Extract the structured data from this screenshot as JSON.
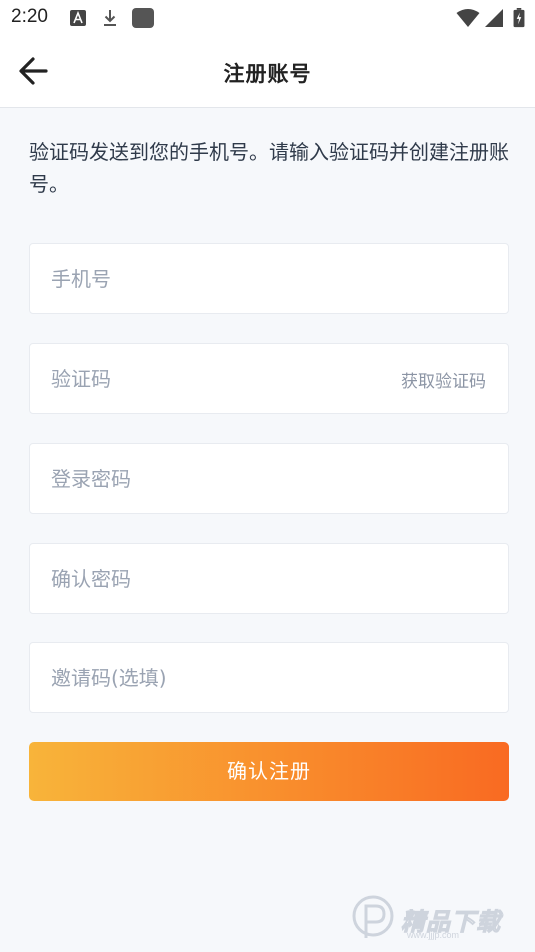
{
  "status_bar": {
    "time": "2:20"
  },
  "header": {
    "title": "注册账号"
  },
  "intro_text": "验证码发送到您的手机号。请输入验证码并创建注册账号。",
  "fields": {
    "phone": {
      "placeholder": "手机号",
      "value": ""
    },
    "code": {
      "placeholder": "验证码",
      "value": "",
      "action_label": "获取验证码"
    },
    "password": {
      "placeholder": "登录密码",
      "value": ""
    },
    "confirm_password": {
      "placeholder": "确认密码",
      "value": ""
    },
    "invite_code": {
      "placeholder": "邀请码(选填)",
      "value": ""
    }
  },
  "submit_label": "确认注册",
  "watermark": {
    "text": "精品下载",
    "url": "www.jjjp.com"
  },
  "colors": {
    "background": "#f6f8fb",
    "button_gradient_start": "#f8b43a",
    "button_gradient_end": "#f96a22",
    "placeholder": "#9aa3b2"
  },
  "icons": [
    "a-icon",
    "download-icon",
    "app-square-icon",
    "wifi-icon",
    "signal-icon",
    "battery-icon",
    "back-arrow-icon"
  ]
}
